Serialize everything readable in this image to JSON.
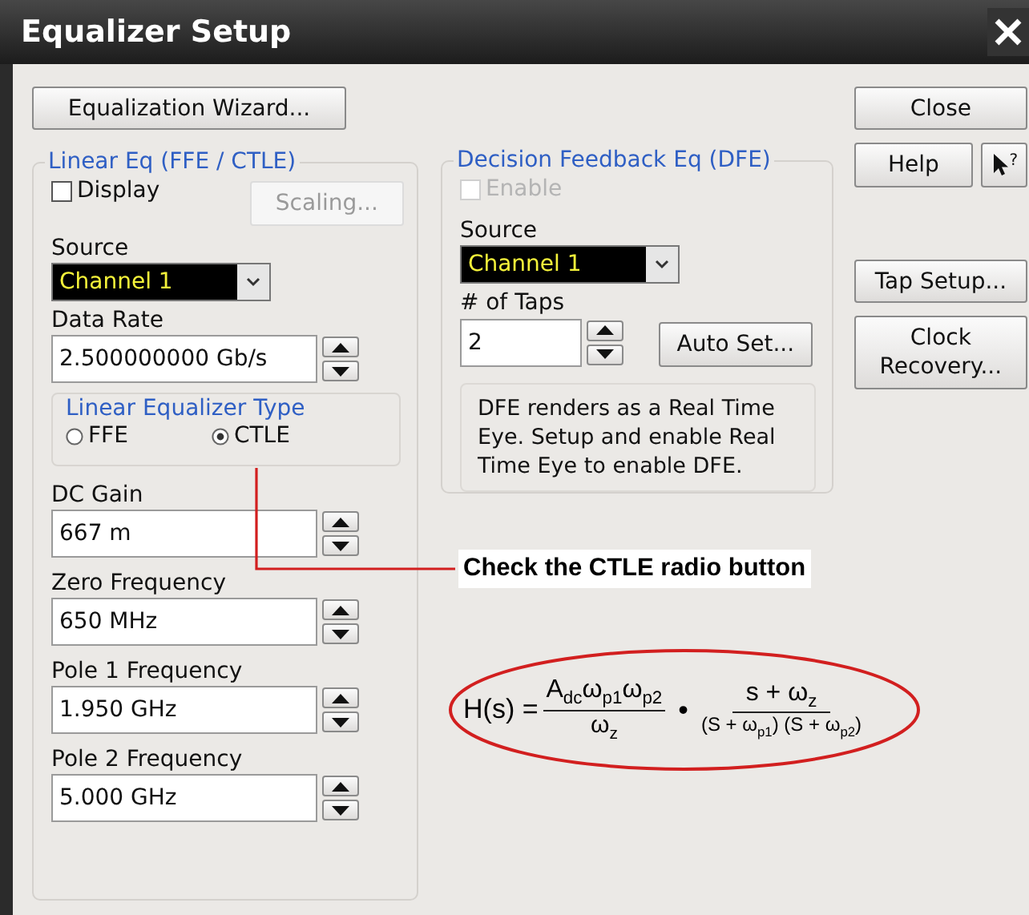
{
  "window": {
    "title": "Equalizer Setup"
  },
  "wizard_button": {
    "label": "Equalization Wizard..."
  },
  "linear_eq": {
    "title": "Linear Eq (FFE / CTLE)",
    "display": {
      "label": "Display",
      "checked": false
    },
    "scaling": {
      "label": "Scaling...",
      "disabled": true
    },
    "source": {
      "label": "Source",
      "value": "Channel 1"
    },
    "data_rate": {
      "label": "Data Rate",
      "value": "2.500000000 Gb/s"
    },
    "type": {
      "title": "Linear Equalizer Type",
      "options": [
        {
          "label": "FFE",
          "selected": false
        },
        {
          "label": "CTLE",
          "selected": true
        }
      ]
    },
    "fields": [
      {
        "label": "DC Gain",
        "value": "667 m"
      },
      {
        "label": "Zero Frequency",
        "value": "650 MHz"
      },
      {
        "label": "Pole 1 Frequency",
        "value": "1.950 GHz"
      },
      {
        "label": "Pole 2 Frequency",
        "value": "5.000 GHz"
      }
    ]
  },
  "dfe": {
    "title": "Decision Feedback Eq (DFE)",
    "enable": {
      "label": "Enable",
      "checked": false,
      "disabled": true
    },
    "source": {
      "label": "Source",
      "value": "Channel 1"
    },
    "taps": {
      "label": "# of Taps",
      "value": "2"
    },
    "auto_set": {
      "label": "Auto Set..."
    },
    "note": "DFE renders as a Real Time Eye. Setup and enable Real Time Eye to enable DFE."
  },
  "side_buttons": [
    {
      "kind": "close",
      "label": "Close"
    },
    {
      "kind": "help",
      "label": "Help",
      "pointer_label": "?"
    },
    {
      "kind": "tap",
      "label": "Tap Setup..."
    },
    {
      "kind": "clock",
      "label": "Clock Recovery..."
    }
  ],
  "annotation": {
    "text": "Check the CTLE radio button"
  },
  "formula": {
    "lhs": "H(s) =",
    "num1": "A$_{dc}$ω$_{p1}$ω$_{p2}$",
    "den1": "ω$_{z}$",
    "dot": "•",
    "num2": "s + ω$_{z}$",
    "den2": "(S + ω$_{p1}$) (S + ω$_{p2}$)"
  }
}
